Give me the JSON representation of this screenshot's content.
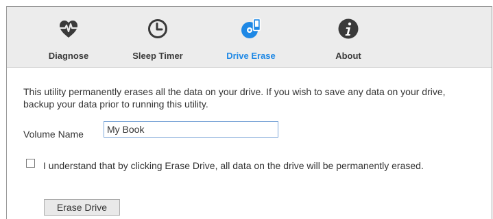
{
  "toolbar": {
    "tabs": [
      {
        "label": "Diagnose",
        "icon": "heart-pulse-icon",
        "active": false
      },
      {
        "label": "Sleep Timer",
        "icon": "clock-icon",
        "active": false
      },
      {
        "label": "Drive Erase",
        "icon": "drive-erase-icon",
        "active": true
      },
      {
        "label": "About",
        "icon": "info-icon",
        "active": false
      }
    ],
    "accent_color": "#1e88e5",
    "icon_color": "#3a3a3a"
  },
  "main": {
    "description": "This utility permanently erases all the data on your drive. If you wish to save any data on your drive, backup your data prior to running this utility.",
    "volume_label": "Volume Name",
    "volume_value": "My Book",
    "confirm_label": "I understand that by clicking Erase Drive, all data on the drive will be permanently erased.",
    "confirm_checked": false,
    "erase_button_label": "Erase Drive"
  }
}
